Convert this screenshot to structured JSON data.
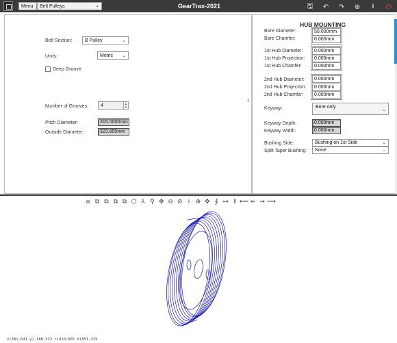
{
  "titlebar": {
    "menu_label": "Menu",
    "module_select": "Belt Pulleys",
    "app_title": "GearTrax-2021",
    "icons": [
      "save-icon",
      "undo-icon",
      "redo-icon",
      "settings-icon",
      "download-icon",
      "power-icon"
    ]
  },
  "left": {
    "belt_section_label": "Belt Section:",
    "belt_section_value": "B Pulley",
    "units_label": "Units:",
    "units_value": "Metric",
    "deep_groove_label": "Deep Groove:",
    "grooves_label": "Number of Grooves:",
    "grooves_value": "4",
    "pitch_label": "Pitch Diameter:",
    "pitch_value": "315.0000mm",
    "outside_label": "Outside Diameter:",
    "outside_value": "323.850mm"
  },
  "hub": {
    "title": "HUB MOUNTING",
    "bore_diameter_label": "Bore Diameter:",
    "bore_diameter_value": "50.000mm",
    "bore_chamfer_label": "Bore Chamfer:",
    "bore_chamfer_value": "0.000mm",
    "hub1_diameter_label": "1st Hub Diameter:",
    "hub1_diameter_value": "0.000mm",
    "hub1_projection_label": "1st Hub Projection:",
    "hub1_projection_value": "0.000mm",
    "hub1_chamfer_label": "1st Hub Chamfer:",
    "hub1_chamfer_value": "0.000mm",
    "hub2_diameter_label": "2nd Hub Diameter:",
    "hub2_diameter_value": "0.000mm",
    "hub2_projection_label": "2nd Hub Projection:",
    "hub2_projection_value": "0.000mm",
    "hub2_chamfer_label": "2nd Hub Chamfer:",
    "hub2_chamfer_value": "0.000mm",
    "keyway_label": "Keyway:",
    "keyway_value": "Bore only",
    "keyway_depth_label": "Keyway Depth:",
    "keyway_depth_value": "0.000mm",
    "keyway_width_label": "Keyway Width:",
    "keyway_width_value": "0.000mm",
    "bushing_side_label": "Bushing Side:",
    "bushing_side_value": "Bushing on 1st Side",
    "split_taper_label": "Split Taper Bushing:",
    "split_taper_value": "None"
  },
  "viewer": {
    "coords": "x)381,641  y)-188,322  r)420,665  d)651,329"
  },
  "colors": {
    "titlebar": "#3a3a3a",
    "model_stroke": "#1a1aa8",
    "power": "#ff4a4a"
  }
}
